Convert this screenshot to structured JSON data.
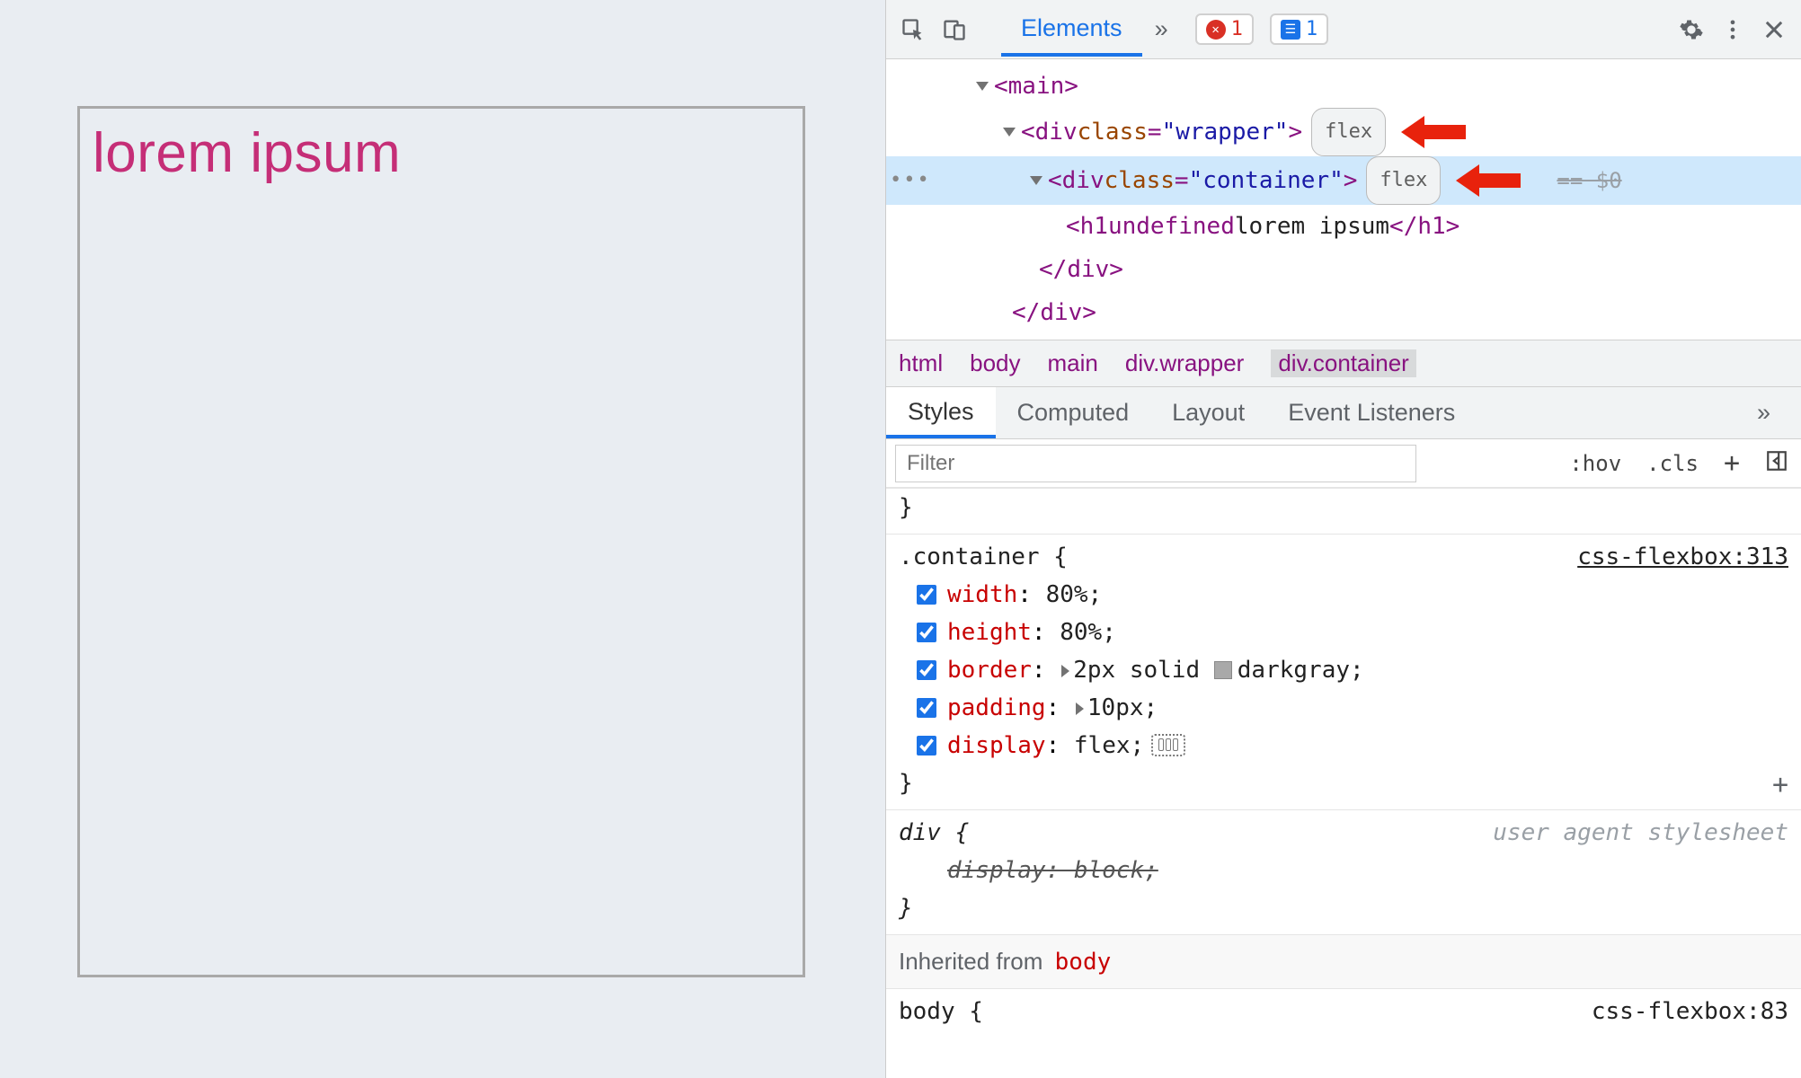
{
  "preview": {
    "heading": "lorem ipsum"
  },
  "toolbar": {
    "tab_elements": "Elements",
    "more_tabs_glyph": "»",
    "error_count": "1",
    "info_count": "1"
  },
  "dom": {
    "rows": [
      {
        "indent": 90,
        "open": "<",
        "tag": "main",
        "attrs": "",
        "close": ">",
        "badge": "",
        "arrow": false,
        "selected": false,
        "expand": true
      },
      {
        "indent": 120,
        "open": "<",
        "tag": "div",
        "attr_name": "class",
        "attr_value": "wrapper",
        "close": ">",
        "badge": "flex",
        "arrow": true,
        "selected": false,
        "expand": true
      },
      {
        "indent": 150,
        "open": "<",
        "tag": "div",
        "attr_name": "class",
        "attr_value": "container",
        "close": ">",
        "badge": "flex",
        "arrow": true,
        "selected": true,
        "expand": true,
        "eq0": "== $0"
      },
      {
        "indent": 190,
        "open": "<",
        "tag": "h1",
        "text": "lorem ipsum",
        "closetag": "h1",
        "selected": false
      },
      {
        "indent": 160,
        "closeonly": "div"
      },
      {
        "indent": 130,
        "closeonly": "div"
      }
    ]
  },
  "breadcrumbs": {
    "items": [
      "html",
      "body",
      "main",
      "div.wrapper",
      "div.container"
    ],
    "selected_index": 4
  },
  "styles_tabs": {
    "items": [
      "Styles",
      "Computed",
      "Layout",
      "Event Listeners"
    ],
    "active_index": 0,
    "overflow_glyph": "»"
  },
  "filter": {
    "placeholder": "Filter",
    "hov": ":hov",
    "cls": ".cls"
  },
  "rules": {
    "container": {
      "selector": ".container {",
      "source": "css-flexbox:313",
      "decls": [
        {
          "prop": "width",
          "sep": ":",
          "val": "80%;",
          "tri": false,
          "swatch": false
        },
        {
          "prop": "height",
          "sep": ":",
          "val": "80%;",
          "tri": false,
          "swatch": false
        },
        {
          "prop": "border",
          "sep": ":",
          "val_pre": "2px solid ",
          "val_post": "darkgray;",
          "tri": true,
          "swatch": true
        },
        {
          "prop": "padding",
          "sep": ":",
          "val": "10px;",
          "tri": true,
          "swatch": false
        },
        {
          "prop": "display",
          "sep": ":",
          "val": "flex;",
          "tri": false,
          "swatch": false,
          "flex_glyph": true
        }
      ],
      "close": "}"
    },
    "ua_div": {
      "selector": "div {",
      "ua_label": "user agent stylesheet",
      "decl_strike": "display: block;",
      "close": "}"
    },
    "inherited_label": "Inherited from",
    "inherited_from": "body",
    "truncated": {
      "selector": "body {",
      "source": "css-flexbox:83"
    }
  }
}
